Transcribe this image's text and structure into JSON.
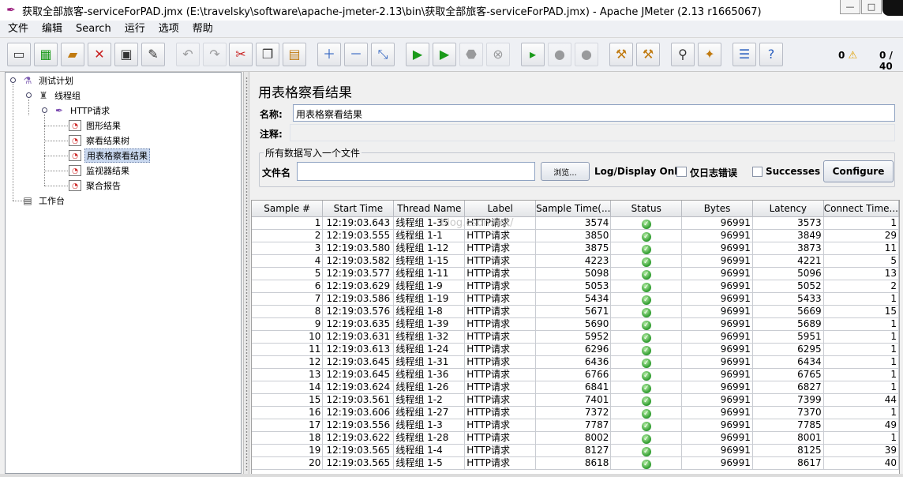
{
  "window": {
    "title": "获取全部旅客-serviceForPAD.jmx (E:\\travelsky\\software\\apache-jmeter-2.13\\bin\\获取全部旅客-serviceForPAD.jmx) - Apache JMeter (2.13 r1665067)",
    "minimize": "—",
    "maximize": "□"
  },
  "menu": [
    "文件",
    "编辑",
    "Search",
    "运行",
    "选项",
    "帮助"
  ],
  "toolbar": {
    "icons": [
      "new-icon",
      "templates-icon",
      "open-icon",
      "close-icon",
      "save-icon",
      "save-as-icon",
      "undo-icon",
      "redo-icon",
      "cut-icon",
      "copy-icon",
      "paste-icon",
      "expand-icon",
      "collapse-icon",
      "toggle-icon",
      "start-icon",
      "start-no-pause-icon",
      "stop-icon",
      "shutdown-icon",
      "remote-start-icon",
      "remote-stop-icon",
      "remote-exit-icon",
      "clear-icon",
      "clear-all-icon",
      "search-icon",
      "reset-search-icon",
      "function-helper-icon",
      "help-icon"
    ],
    "error_count": "0",
    "threads": "0 / 40"
  },
  "tree": {
    "nodes": [
      {
        "label": "测试计划"
      },
      {
        "label": "线程组"
      },
      {
        "label": "HTTP请求"
      },
      {
        "label": "图形结果"
      },
      {
        "label": "察看结果树"
      },
      {
        "label": "用表格察看结果"
      },
      {
        "label": "监视器结果"
      },
      {
        "label": "聚合报告"
      },
      {
        "label": "工作台"
      }
    ]
  },
  "panel": {
    "title": "用表格察看结果",
    "name_label": "名称:",
    "name_value": "用表格察看结果",
    "comment_label": "注释:",
    "comment_value": "",
    "file_section": "所有数据写入一个文件",
    "filename_label": "文件名",
    "filename_value": "",
    "browse_button": "浏览...",
    "log_display_label": "Log/Display Only:",
    "errors_only_label": "仅日志错误",
    "successes_label": "Successes",
    "configure_button": "Configure"
  },
  "table": {
    "columns": [
      "Sample #",
      "Start Time",
      "Thread Name",
      "Label",
      "Sample Time(...",
      "Status",
      "Bytes",
      "Latency",
      "Connect Time..."
    ],
    "rows": [
      [
        "1",
        "12:19:03.643",
        "线程组 1-35",
        "HTTP请求",
        "3574",
        "ok",
        "96991",
        "3573",
        "1"
      ],
      [
        "2",
        "12:19:03.555",
        "线程组 1-1",
        "HTTP请求",
        "3850",
        "ok",
        "96991",
        "3849",
        "29"
      ],
      [
        "3",
        "12:19:03.580",
        "线程组 1-12",
        "HTTP请求",
        "3875",
        "ok",
        "96991",
        "3873",
        "11"
      ],
      [
        "4",
        "12:19:03.582",
        "线程组 1-15",
        "HTTP请求",
        "4223",
        "ok",
        "96991",
        "4221",
        "5"
      ],
      [
        "5",
        "12:19:03.577",
        "线程组 1-11",
        "HTTP请求",
        "5098",
        "ok",
        "96991",
        "5096",
        "13"
      ],
      [
        "6",
        "12:19:03.629",
        "线程组 1-9",
        "HTTP请求",
        "5053",
        "ok",
        "96991",
        "5052",
        "2"
      ],
      [
        "7",
        "12:19:03.586",
        "线程组 1-19",
        "HTTP请求",
        "5434",
        "ok",
        "96991",
        "5433",
        "1"
      ],
      [
        "8",
        "12:19:03.576",
        "线程组 1-8",
        "HTTP请求",
        "5671",
        "ok",
        "96991",
        "5669",
        "15"
      ],
      [
        "9",
        "12:19:03.635",
        "线程组 1-39",
        "HTTP请求",
        "5690",
        "ok",
        "96991",
        "5689",
        "1"
      ],
      [
        "10",
        "12:19:03.631",
        "线程组 1-32",
        "HTTP请求",
        "5952",
        "ok",
        "96991",
        "5951",
        "1"
      ],
      [
        "11",
        "12:19:03.613",
        "线程组 1-24",
        "HTTP请求",
        "6296",
        "ok",
        "96991",
        "6295",
        "1"
      ],
      [
        "12",
        "12:19:03.645",
        "线程组 1-31",
        "HTTP请求",
        "6436",
        "ok",
        "96991",
        "6434",
        "1"
      ],
      [
        "13",
        "12:19:03.645",
        "线程组 1-36",
        "HTTP请求",
        "6766",
        "ok",
        "96991",
        "6765",
        "1"
      ],
      [
        "14",
        "12:19:03.624",
        "线程组 1-26",
        "HTTP请求",
        "6841",
        "ok",
        "96991",
        "6827",
        "1"
      ],
      [
        "15",
        "12:19:03.561",
        "线程组 1-2",
        "HTTP请求",
        "7401",
        "ok",
        "96991",
        "7399",
        "44"
      ],
      [
        "16",
        "12:19:03.606",
        "线程组 1-27",
        "HTTP请求",
        "7372",
        "ok",
        "96991",
        "7370",
        "1"
      ],
      [
        "17",
        "12:19:03.556",
        "线程组 1-3",
        "HTTP请求",
        "7787",
        "ok",
        "96991",
        "7785",
        "49"
      ],
      [
        "18",
        "12:19:03.622",
        "线程组 1-28",
        "HTTP请求",
        "8002",
        "ok",
        "96991",
        "8001",
        "1"
      ],
      [
        "19",
        "12:19:03.565",
        "线程组 1-4",
        "HTTP请求",
        "8127",
        "ok",
        "96991",
        "8125",
        "39"
      ],
      [
        "20",
        "12:19:03.565",
        "线程组 1-5",
        "HTTP请求",
        "8618",
        "ok",
        "96991",
        "8617",
        "40"
      ]
    ]
  },
  "watermark": "blog.csdn.net/"
}
